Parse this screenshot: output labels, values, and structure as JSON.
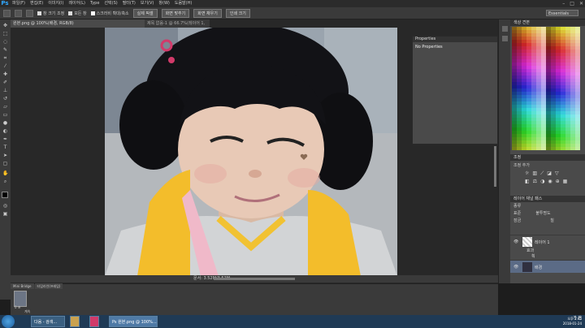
{
  "app": {
    "logo": "Ps"
  },
  "menubar": {
    "items": [
      "파일(F)",
      "편집(E)",
      "이미지(I)",
      "레이어(L)",
      "Type",
      "선택(S)",
      "필터(T)",
      "보기(V)",
      "창(W)",
      "도움말(H)"
    ],
    "window_controls": [
      "–",
      "□",
      "✕"
    ]
  },
  "options": {
    "all_windows": "창 크기 조정",
    "all_windows_on": false,
    "zoom_all": "모든 창",
    "zoom_all_on": false,
    "scrubby": "스크러비 확대/축소",
    "scrubby_on": true,
    "actual_pixels": "실제 픽셀",
    "fit_screen": "화면 맞추기",
    "fill_screen": "화면 채우기",
    "print_size": "인쇄 크기",
    "workspace": "Essentials"
  },
  "document": {
    "tab_title": "원본.png @ 100%(배경, RGB/8)",
    "tab2_title": "제목 없음-1 @ 66.7%(레이어 1, RGB/8)",
    "status": "문서: 3.52M/3.52M"
  },
  "properties": {
    "title": "Properties",
    "content": "No Properties"
  },
  "swatches": {
    "title": "색상 견본"
  },
  "adjustments": {
    "title": "조정",
    "label": "조정 추가"
  },
  "layers": {
    "tabs": "레이어 채널 패스",
    "kind": "종류",
    "blend_mode": "표준",
    "opacity": "불투명도",
    "lock": "잠금",
    "fill": "칠",
    "items": [
      {
        "name": "레이어 1",
        "sub": "효과"
      },
      {
        "name": "배경"
      }
    ],
    "sub_effect": "획"
  },
  "mini_bridge": {
    "tabs": [
      "Mini Bridge",
      "타임라인(프레임)"
    ],
    "frame_label": "0 초",
    "loop": "계속"
  },
  "taskbar": {
    "items": [
      "다음 - 검색...",
      "Ps 원본.png @ 100%..."
    ],
    "tray_time": "오후 2:45",
    "tray_date": "2018-01-24",
    "ime": "가 한"
  },
  "colors": {
    "accent": "#31a8ff",
    "foreground": "#000000",
    "background": "#1f4fd0"
  }
}
